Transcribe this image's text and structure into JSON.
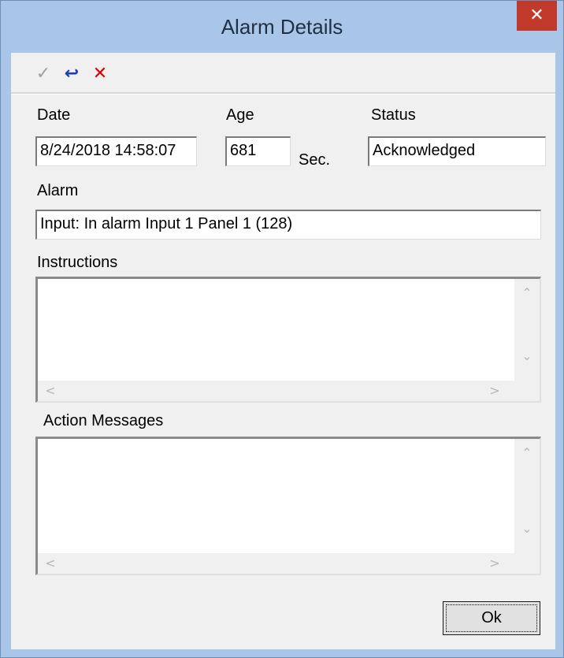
{
  "window": {
    "title": "Alarm Details",
    "close_symbol": "✕"
  },
  "toolbar": {
    "accept_icon": "check-icon",
    "accept_glyph": "✓",
    "undo_icon": "undo-icon",
    "undo_glyph": "↩",
    "cancel_icon": "x-icon",
    "cancel_glyph": "✕"
  },
  "fields": {
    "date_label": "Date",
    "date_value": "8/24/2018 14:58:07",
    "age_label": "Age",
    "age_value": "681",
    "age_unit": "Sec.",
    "status_label": "Status",
    "status_value": "Acknowledged",
    "alarm_label": "Alarm",
    "alarm_value": "Input: In alarm Input 1  Panel 1 (128)",
    "instructions_label": "Instructions",
    "instructions_value": "",
    "action_messages_label": "Action Messages",
    "action_messages_value": ""
  },
  "scroll_glyphs": {
    "up": "⌃",
    "down": "⌄",
    "left": "<",
    "right": ">"
  },
  "footer": {
    "ok_label": "Ok"
  },
  "colors": {
    "titlebar": "#a9c6e8",
    "close": "#c0392b",
    "undo": "#1a3fb0",
    "cancel": "#e00000"
  }
}
